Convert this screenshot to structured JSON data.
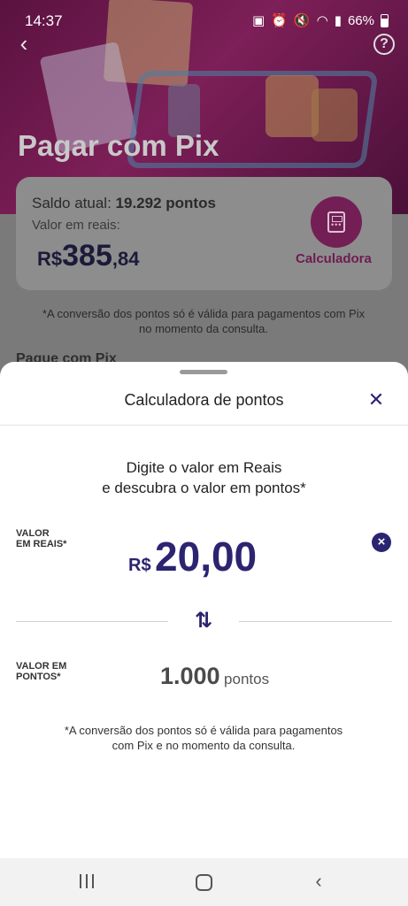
{
  "status_bar": {
    "time": "14:37",
    "battery": "66%"
  },
  "background_page": {
    "title": "Pagar com Pix",
    "balance": {
      "saldo_label": "Saldo atual:",
      "saldo_value": "19.292 pontos",
      "valor_label": "Valor em reais:",
      "currency": "R$",
      "amount_integer": "385",
      "amount_decimal": ",84"
    },
    "calculator_label": "Calculadora",
    "note": "*A conversão dos pontos só é válida para pagamentos com Pix no momento da consulta.",
    "section_title": "Pague com Pix"
  },
  "sheet": {
    "title": "Calculadora de pontos",
    "prompt_line1": "Digite o valor em Reais",
    "prompt_line2": "e descubra o valor em pontos*",
    "reais_label_line1": "VALOR",
    "reais_label_line2": "EM REAIS*",
    "reais_currency": "R$",
    "reais_value": "20,00",
    "pontos_label_line1": "VALOR EM",
    "pontos_label_line2": "PONTOS*",
    "pontos_value": "1.000",
    "pontos_unit": "pontos",
    "note_line1": "*A conversão dos pontos só é válida para pagamentos",
    "note_line2": "com Pix e no momento da consulta."
  },
  "colors": {
    "brand_magenta": "#c2187a",
    "brand_navy": "#2b2470"
  },
  "icons": {
    "back": "back-arrow-icon",
    "help": "help-icon",
    "calculator": "calculator-icon",
    "close": "close-icon",
    "clear": "clear-circle-icon",
    "swap": "swap-vertical-icon"
  }
}
